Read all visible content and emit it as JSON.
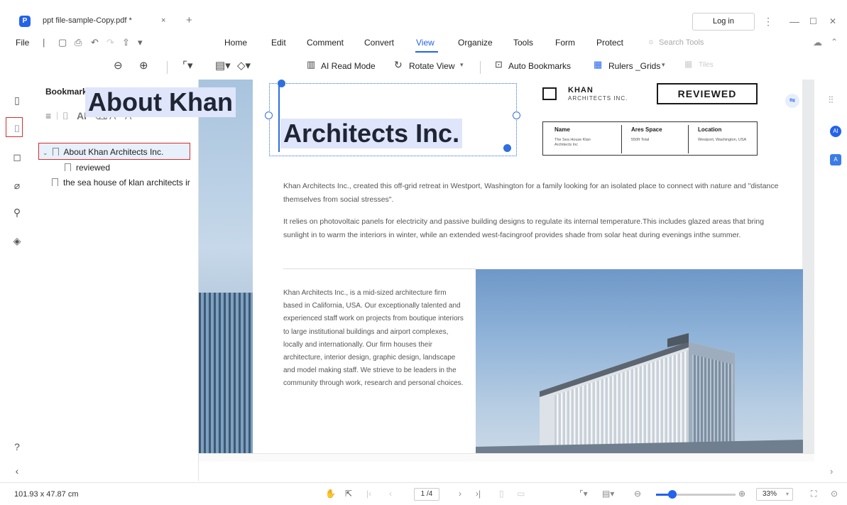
{
  "app": {
    "logo_letter": "P",
    "tab_title": "ppt file-sample-Copy.pdf *",
    "tab_close": "×",
    "new_tab": "+",
    "login": "Log in",
    "controls": [
      "⋮",
      "—",
      "☐",
      "✕"
    ]
  },
  "menu": {
    "file": "File",
    "items": [
      "Home",
      "Edit",
      "Comment",
      "Convert",
      "View",
      "Organize",
      "Tools",
      "Form",
      "Protect"
    ],
    "active": "View",
    "search_tools": "Search Tools"
  },
  "toolbar": {
    "ai_read": "AI Read Mode",
    "rotate": "Rotate View",
    "auto_bookmarks": "Auto Bookmarks",
    "rulers": "Rulers _Grids",
    "tiles": "Tiles"
  },
  "bookmarks": {
    "title": "Bookmarks",
    "close": "×",
    "items": [
      {
        "label": "About Khan Architects Inc.",
        "level": 0
      },
      {
        "label": "reviewed",
        "level": 1
      },
      {
        "label": "the sea house of klan architects ir",
        "level": 0
      }
    ]
  },
  "doc": {
    "headline_1": "About Khan",
    "headline_2": "Architects Inc.",
    "logo_name": "KHAN",
    "logo_sub": "ARCHITECTS INC.",
    "stamp": "REVIEWED",
    "table": {
      "headers": [
        "Name",
        "Ares Space",
        "Location"
      ],
      "values": [
        "The Sea House Klan Architects Inc",
        "550ft Total",
        "Westport, Washington, USA"
      ]
    },
    "para1": "Khan Architects Inc., created this off-grid retreat in Westport, Washington for a family looking for an isolated place to connect with nature and \"distance themselves from social stresses\".",
    "para2": "It relies on photovoltaic panels for electricity and passive building designs to regulate its internal temperature.This includes glazed areas that bring sunlight in to warm the interiors in winter, while an extended west-facingroof provides shade from solar heat during evenings inthe summer.",
    "para3": "Khan Architects Inc., is a mid-sized architecture firm based in California, USA. Our exceptionally talented and experienced staff work on projects from boutique interiors to large institutional buildings and airport complexes, locally and internationally. Our firm houses their architecture, interior design, graphic design, landscape and model making staff. We strieve to be leaders in the community through work, research and personal choices."
  },
  "status": {
    "dimensions": "101.93 x 47.87 cm",
    "page": "1 /4",
    "zoom": "33%"
  },
  "colors": {
    "accent": "#2463eb",
    "highlight_border": "#d32f2f",
    "selection_bg": "#dfe5fb"
  }
}
